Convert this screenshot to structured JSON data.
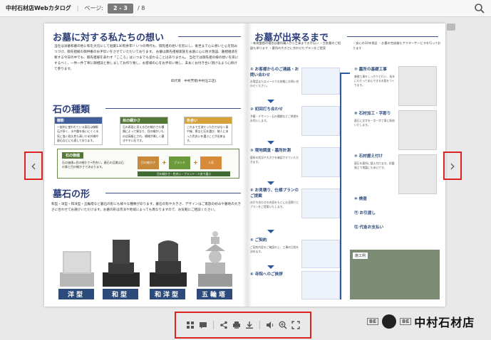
{
  "topbar": {
    "app_title": "中村石材店Webカタログ",
    "page_label": "ページ:",
    "page_value": "2 - 3",
    "page_total": "8"
  },
  "left_page": {
    "title": "お墓に対する私たちの想い",
    "intro": "当社は洋墓和墓の他に和を大切にして創業130有余年!! いつの時代も、御先祖の想いを形にし、後世まで心に想いと心を刻みつづけ、御先祖様の御供養のお手伝いをさせていただいております。 お墓は御先祖様家族を永遠に心に残す施設、墓相継承を要する今日の中でも、御先祖様を表わす「こころ」はいつまでも変わることはありません。 当社では御先祖の様の想いを形にするべく、一件一件丁寧に御相談と致しましてお作り致し、お客様の心をお手伝い致し、末永くお付き合い頂けるよう心掛けて参ります。",
    "signature": "四代目　中村芳徳(中村石工店)",
    "stone_section": {
      "title": "石の種類",
      "boxes": [
        {
          "label": "御影",
          "color": "#3f5f9a",
          "text": "一般的に使われている墓石は御影石が多く、水や酸を吸いにくく水気に強く耐久性も高いため外柵や墓石などにも適しております。"
        },
        {
          "label": "目の細かさ",
          "color": "#55783a",
          "text": "石の表面に見える目の細かさも種類によって異なり、目の細かいものは高級とされ、模様が美しく磨きやすい石です。"
        },
        {
          "label": "色合い",
          "color": "#d6a23a",
          "text": "これまで主流だった白ではなく青や緑、黒など石を選び、故人にあった色合いを選ぶことが出来ます。"
        }
      ],
      "grain_label": "石の価値",
      "grain_text": "石の価値=目の細かさ+色合い。墓石の品質は石の質と目の細かさで決まります。",
      "grain_boxes": [
        {
          "label": "目の細かさ",
          "color": "#c88a3a"
        },
        {
          "label": "ブランド",
          "color": "#6a9a3a"
        },
        {
          "label": "人気",
          "color": "#d68a3a"
        }
      ],
      "grain_bar": "目の細かさ・色合い・ブランド・人気で選ぶ"
    },
    "shape_section": {
      "title": "墓石の形",
      "intro": "和型・洋型・和洋型・五輪塔など墓石の形にも様々な種類があります。墓石の形や大きさ、デザインはご家族の好みや墓地の大きさに合わせてお選びいただけます。お墓の形は宗派や地域によっても異なりますので、お気軽にご相談ください。",
      "captions": [
        "洋型",
        "和型",
        "和洋型",
        "五輪塔"
      ]
    }
  },
  "right_page": {
    "title": "お墓が出来るまで",
    "note_left": "・新規霊園の場合は墓所購入から工事までお手伝い ・生前墓のご相談も承ります ・墓所の大きさに合わせたプランをご提案",
    "note_right": "・安心の10年保証 ・お墓の完成後もアフターサービスを行っております",
    "steps_left": [
      {
        "title": "① お客様からのご連絡・お問い合わせ",
        "desc": "お電話またはメールでお気軽にお問い合わせください。"
      },
      {
        "title": "② 初回打ち合わせ",
        "desc": "予算・デザイン・石の種類などご希望をお伺いします。"
      },
      {
        "title": "③ 現地調査・墓所計測",
        "desc": "墓所の状況や大きさを確認させていただきます。"
      },
      {
        "title": "④ お見積り、仕様プランのご提案",
        "desc": "お打ち合わせの内容をもとにお見積りとプランをご提案いたします。"
      },
      {
        "title": "⑤ ご契約",
        "desc": "ご契約内容をご確認の上、工事の日程を決めます。"
      },
      {
        "title": "⑥ 寺院へのご挨拶",
        "desc": ""
      }
    ],
    "steps_right": [
      {
        "title": "⑦ 墓所の基礎工事",
        "desc": "基礎工事をしっかりと行い、長年にわたって安心できるお墓をつくります。"
      },
      {
        "title": "⑧ 石材加工・字彫り",
        "desc": "墓石に文字を一字一字丁寧に彫刻いたします。"
      },
      {
        "title": "⑨ 石材据え付け",
        "desc": "墓石を墓所に据え付けます。耐震施工で地震にも安心です。"
      },
      {
        "title": "⑩ 検査",
        "desc": ""
      },
      {
        "title": "⑪ お引渡し",
        "desc": ""
      },
      {
        "title": "⑫ 代金お支払い",
        "desc": ""
      }
    ],
    "finish_label": "施工例"
  },
  "navigation": {
    "prev": "‹",
    "next": "›"
  },
  "brand": {
    "small_left": "BE",
    "small_right": "BE",
    "name": "中村石材店"
  },
  "colors": {
    "accent": "#2c5aa0",
    "highlight_border": "#dd2222",
    "title_navy": "#2c3e7a"
  }
}
